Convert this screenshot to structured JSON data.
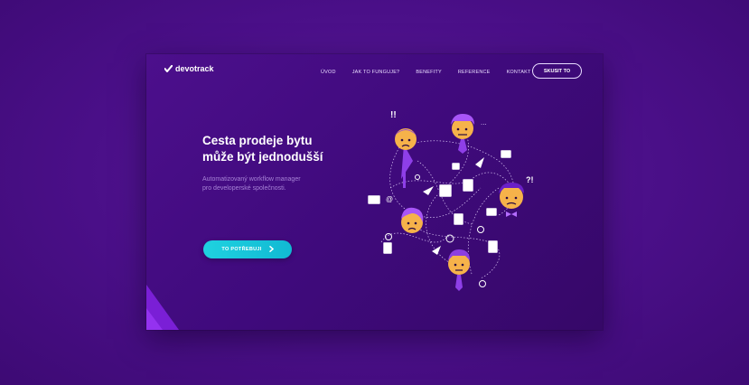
{
  "brand": {
    "name": "devotrack"
  },
  "nav": {
    "items": [
      "ÚVOD",
      "JAK TO FUNGUJE?",
      "BENEFITY",
      "REFERENCE",
      "KONTAKT"
    ],
    "cta": "SKUSIT TO"
  },
  "hero": {
    "title_line1": "Cesta prodeje bytu",
    "title_line2": "může být jednodušší",
    "subtitle_line1": "Automatizovaný workflow manager",
    "subtitle_line2": "pro developerské společnosti.",
    "button_label": "TO POTŘEBUJI",
    "button_icon": "chevron-right-icon"
  },
  "illustration": {
    "exclaim_1": "!!",
    "exclaim_2": "?!",
    "dots": "...",
    "mark": "@"
  },
  "colors": {
    "background": "#4a0f88",
    "frame": "#3f0a7c",
    "accent_cyan": "#1fd2e0",
    "accent_purple": "#9b4ef0",
    "face": "#f6b24a"
  }
}
